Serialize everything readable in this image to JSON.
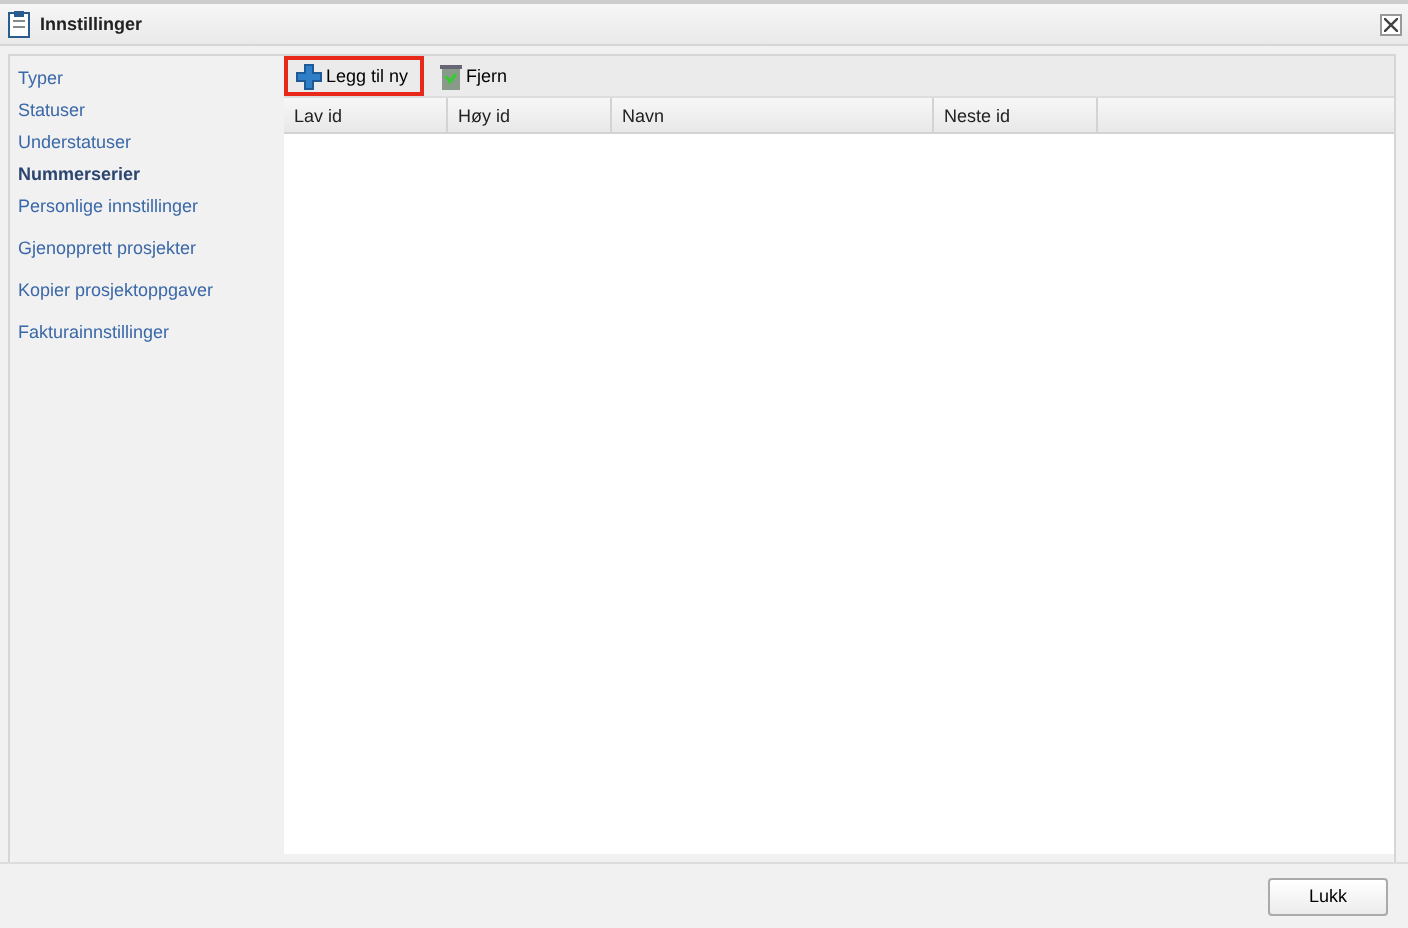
{
  "window": {
    "title": "Innstillinger"
  },
  "sidebar": {
    "groups": [
      {
        "items": [
          {
            "label": "Typer",
            "selected": false
          },
          {
            "label": "Statuser",
            "selected": false
          },
          {
            "label": "Understatuser",
            "selected": false
          },
          {
            "label": "Nummerserier",
            "selected": true
          },
          {
            "label": "Personlige innstillinger",
            "selected": false
          }
        ]
      },
      {
        "items": [
          {
            "label": "Gjenopprett prosjekter",
            "selected": false
          }
        ]
      },
      {
        "items": [
          {
            "label": "Kopier prosjektoppgaver",
            "selected": false
          }
        ]
      },
      {
        "items": [
          {
            "label": "Fakturainnstillinger",
            "selected": false
          }
        ]
      }
    ]
  },
  "toolbar": [
    {
      "kind": "add",
      "label": "Legg til ny",
      "highlighted": true
    },
    {
      "kind": "remove",
      "label": "Fjern",
      "highlighted": false
    }
  ],
  "table": {
    "columns": [
      "Lav id",
      "Høy id",
      "Navn",
      "Neste id"
    ]
  },
  "buttons": [
    "Lukk"
  ]
}
